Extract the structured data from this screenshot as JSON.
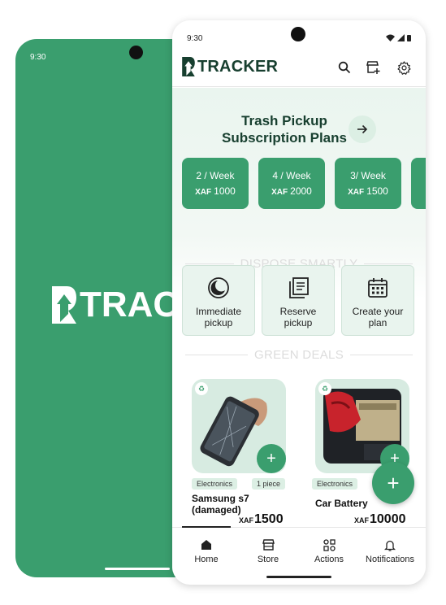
{
  "colors": {
    "brand_green": "#3a9e6e",
    "dark_green": "#173f2f",
    "light_green": "#e9f4ee"
  },
  "splash": {
    "status_time": "9:30",
    "logo_text": "TRACKER"
  },
  "status_bar": {
    "time": "9:30"
  },
  "app_bar": {
    "logo_text": "TRACKER",
    "actions": [
      "search-icon",
      "store-add-icon",
      "gear-icon"
    ]
  },
  "subscription": {
    "title": "Trash Pickup Subscription Plans",
    "plans": [
      {
        "frequency": "2 / Week",
        "currency": "XAF",
        "amount": "1000"
      },
      {
        "frequency": "4 / Week",
        "currency": "XAF",
        "amount": "2000"
      },
      {
        "frequency": "3/ Week",
        "currency": "XAF",
        "amount": "1500"
      }
    ]
  },
  "dispose": {
    "heading": "DISPOSE SMARTLY",
    "actions": [
      {
        "label": "Immediate pickup",
        "icon": "moon-icon"
      },
      {
        "label": "Reserve pickup",
        "icon": "documents-icon"
      },
      {
        "label": "Create your plan",
        "icon": "calendar-icon"
      }
    ]
  },
  "deals": {
    "heading": "GREEN DEALS",
    "items": [
      {
        "category": "Electronics",
        "quantity": "1 piece",
        "name": "Samsung s7 (damaged)",
        "currency": "XAF",
        "price": "1500"
      },
      {
        "category": "Electronics",
        "name": "Car Battery",
        "currency": "XAF",
        "price": "10000"
      }
    ]
  },
  "nav": {
    "items": [
      {
        "label": "Home",
        "icon": "home-icon"
      },
      {
        "label": "Store",
        "icon": "store-icon"
      },
      {
        "label": "Actions",
        "icon": "actions-icon"
      },
      {
        "label": "Notifications",
        "icon": "bell-icon"
      }
    ]
  }
}
